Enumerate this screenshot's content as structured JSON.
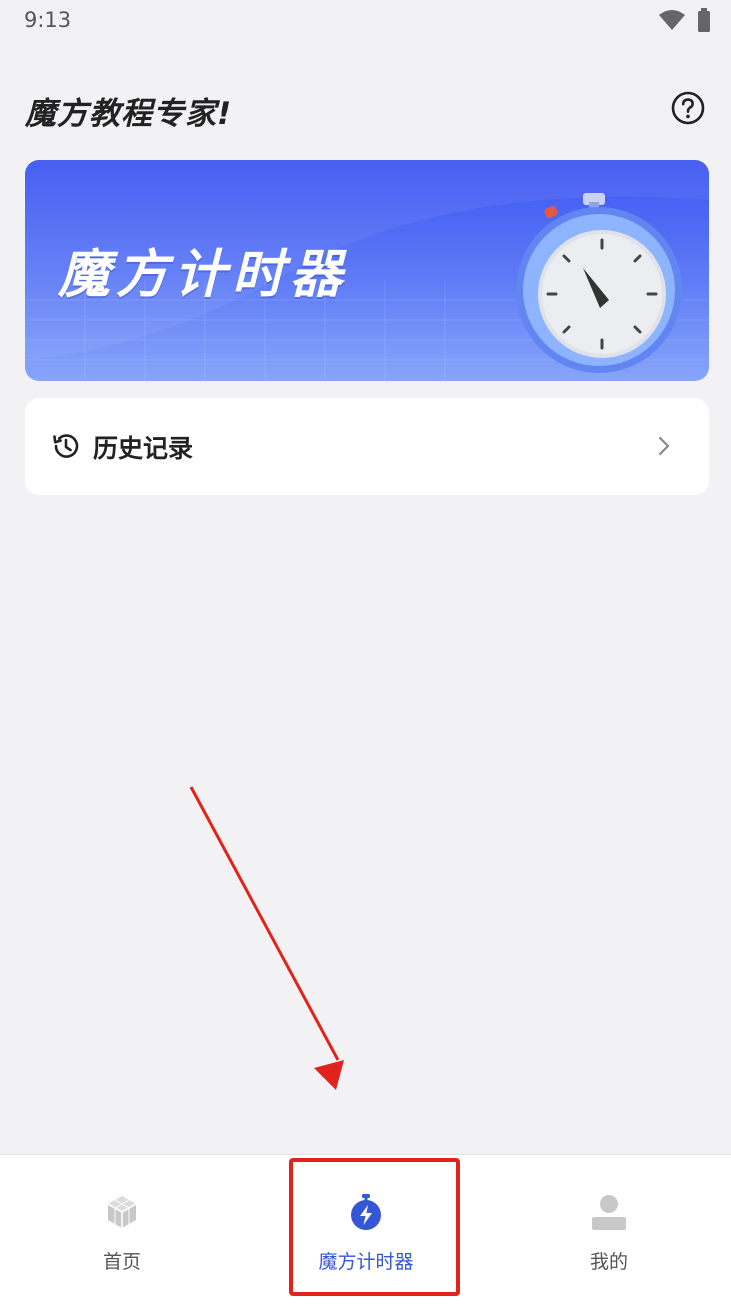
{
  "status_bar": {
    "time": "9:13"
  },
  "header": {
    "title": "魔方教程专家!"
  },
  "banner": {
    "title": "魔方计时器"
  },
  "history": {
    "label": "历史记录"
  },
  "bottom_nav": {
    "items": [
      {
        "label": "首页",
        "icon": "cube-icon",
        "active": false
      },
      {
        "label": "魔方计时器",
        "icon": "timer-icon",
        "active": true
      },
      {
        "label": "我的",
        "icon": "person-icon",
        "active": false
      }
    ]
  },
  "colors": {
    "accent": "#3557d6",
    "banner": "#4a63f4",
    "annotation": "#e0231c"
  }
}
